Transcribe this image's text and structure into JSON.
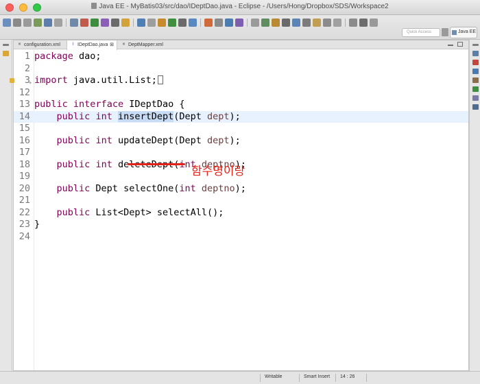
{
  "window": {
    "title": "Java EE - MyBatis03/src/dao/IDeptDao.java - Eclipse - /Users/Hong/Dropbox/SDS/Workspace2"
  },
  "toolbar": {
    "quick_access_placeholder": "Quick Access",
    "perspective_label": "Java EE"
  },
  "tabs": [
    {
      "label": "configuration.xml",
      "icon": "xml-file-icon",
      "active": false
    },
    {
      "label": "IDeptDao.java",
      "icon": "java-interface-icon",
      "active": true,
      "close": "⊠"
    },
    {
      "label": "DeptMapper.xml",
      "icon": "xml-file-icon",
      "active": false
    }
  ],
  "code_lines": [
    {
      "num": "1",
      "tokens": [
        {
          "t": "package",
          "c": "kw"
        },
        {
          "t": " dao;"
        }
      ]
    },
    {
      "num": "2",
      "tokens": []
    },
    {
      "num": "3",
      "fold": "+",
      "tokens": [
        {
          "t": "import",
          "c": "kw"
        },
        {
          "t": " java.util.List;"
        }
      ],
      "collapsed": true
    },
    {
      "num": "12",
      "tokens": []
    },
    {
      "num": "13",
      "tokens": [
        {
          "t": "public",
          "c": "kw"
        },
        {
          "t": " "
        },
        {
          "t": "interface",
          "c": "kw"
        },
        {
          "t": " IDeptDao {"
        }
      ]
    },
    {
      "num": "14",
      "current": true,
      "tokens": [
        {
          "t": "    "
        },
        {
          "t": "public",
          "c": "kw"
        },
        {
          "t": " "
        },
        {
          "t": "int",
          "c": "kw"
        },
        {
          "t": " "
        },
        {
          "t": "insertDept",
          "c": "sel"
        },
        {
          "t": "(Dept "
        },
        {
          "t": "dept",
          "c": "param"
        },
        {
          "t": ");"
        }
      ]
    },
    {
      "num": "15",
      "tokens": []
    },
    {
      "num": "16",
      "tokens": [
        {
          "t": "    "
        },
        {
          "t": "public",
          "c": "kw"
        },
        {
          "t": " "
        },
        {
          "t": "int",
          "c": "kw"
        },
        {
          "t": " updateDept(Dept "
        },
        {
          "t": "dept",
          "c": "param"
        },
        {
          "t": ");"
        }
      ]
    },
    {
      "num": "17",
      "tokens": []
    },
    {
      "num": "18",
      "tokens": [
        {
          "t": "    "
        },
        {
          "t": "public",
          "c": "kw"
        },
        {
          "t": " "
        },
        {
          "t": "int",
          "c": "kw"
        },
        {
          "t": " deleteDept("
        },
        {
          "t": "int",
          "c": "kw"
        },
        {
          "t": " "
        },
        {
          "t": "deptno",
          "c": "param"
        },
        {
          "t": ");"
        }
      ]
    },
    {
      "num": "19",
      "tokens": []
    },
    {
      "num": "20",
      "tokens": [
        {
          "t": "    "
        },
        {
          "t": "public",
          "c": "kw"
        },
        {
          "t": " Dept selectOne("
        },
        {
          "t": "int",
          "c": "kw"
        },
        {
          "t": " "
        },
        {
          "t": "deptno",
          "c": "param"
        },
        {
          "t": ");"
        }
      ]
    },
    {
      "num": "21",
      "tokens": []
    },
    {
      "num": "22",
      "tokens": [
        {
          "t": "    "
        },
        {
          "t": "public",
          "c": "kw"
        },
        {
          "t": " List<Dept> selectAll();"
        }
      ]
    },
    {
      "num": "23",
      "tokens": [
        {
          "t": "}"
        }
      ]
    },
    {
      "num": "24",
      "tokens": []
    }
  ],
  "annotation": {
    "text": "함수명이랑",
    "color": "#e2231a"
  },
  "statusbar": {
    "writable": "Writable",
    "insert_mode": "Smart Insert",
    "position": "14 : 26"
  },
  "colors": {
    "keyword": "#7f0055",
    "parameter": "#6a3e3e",
    "current_line": "#e8f2fe",
    "selection": "#c7dbf5"
  }
}
